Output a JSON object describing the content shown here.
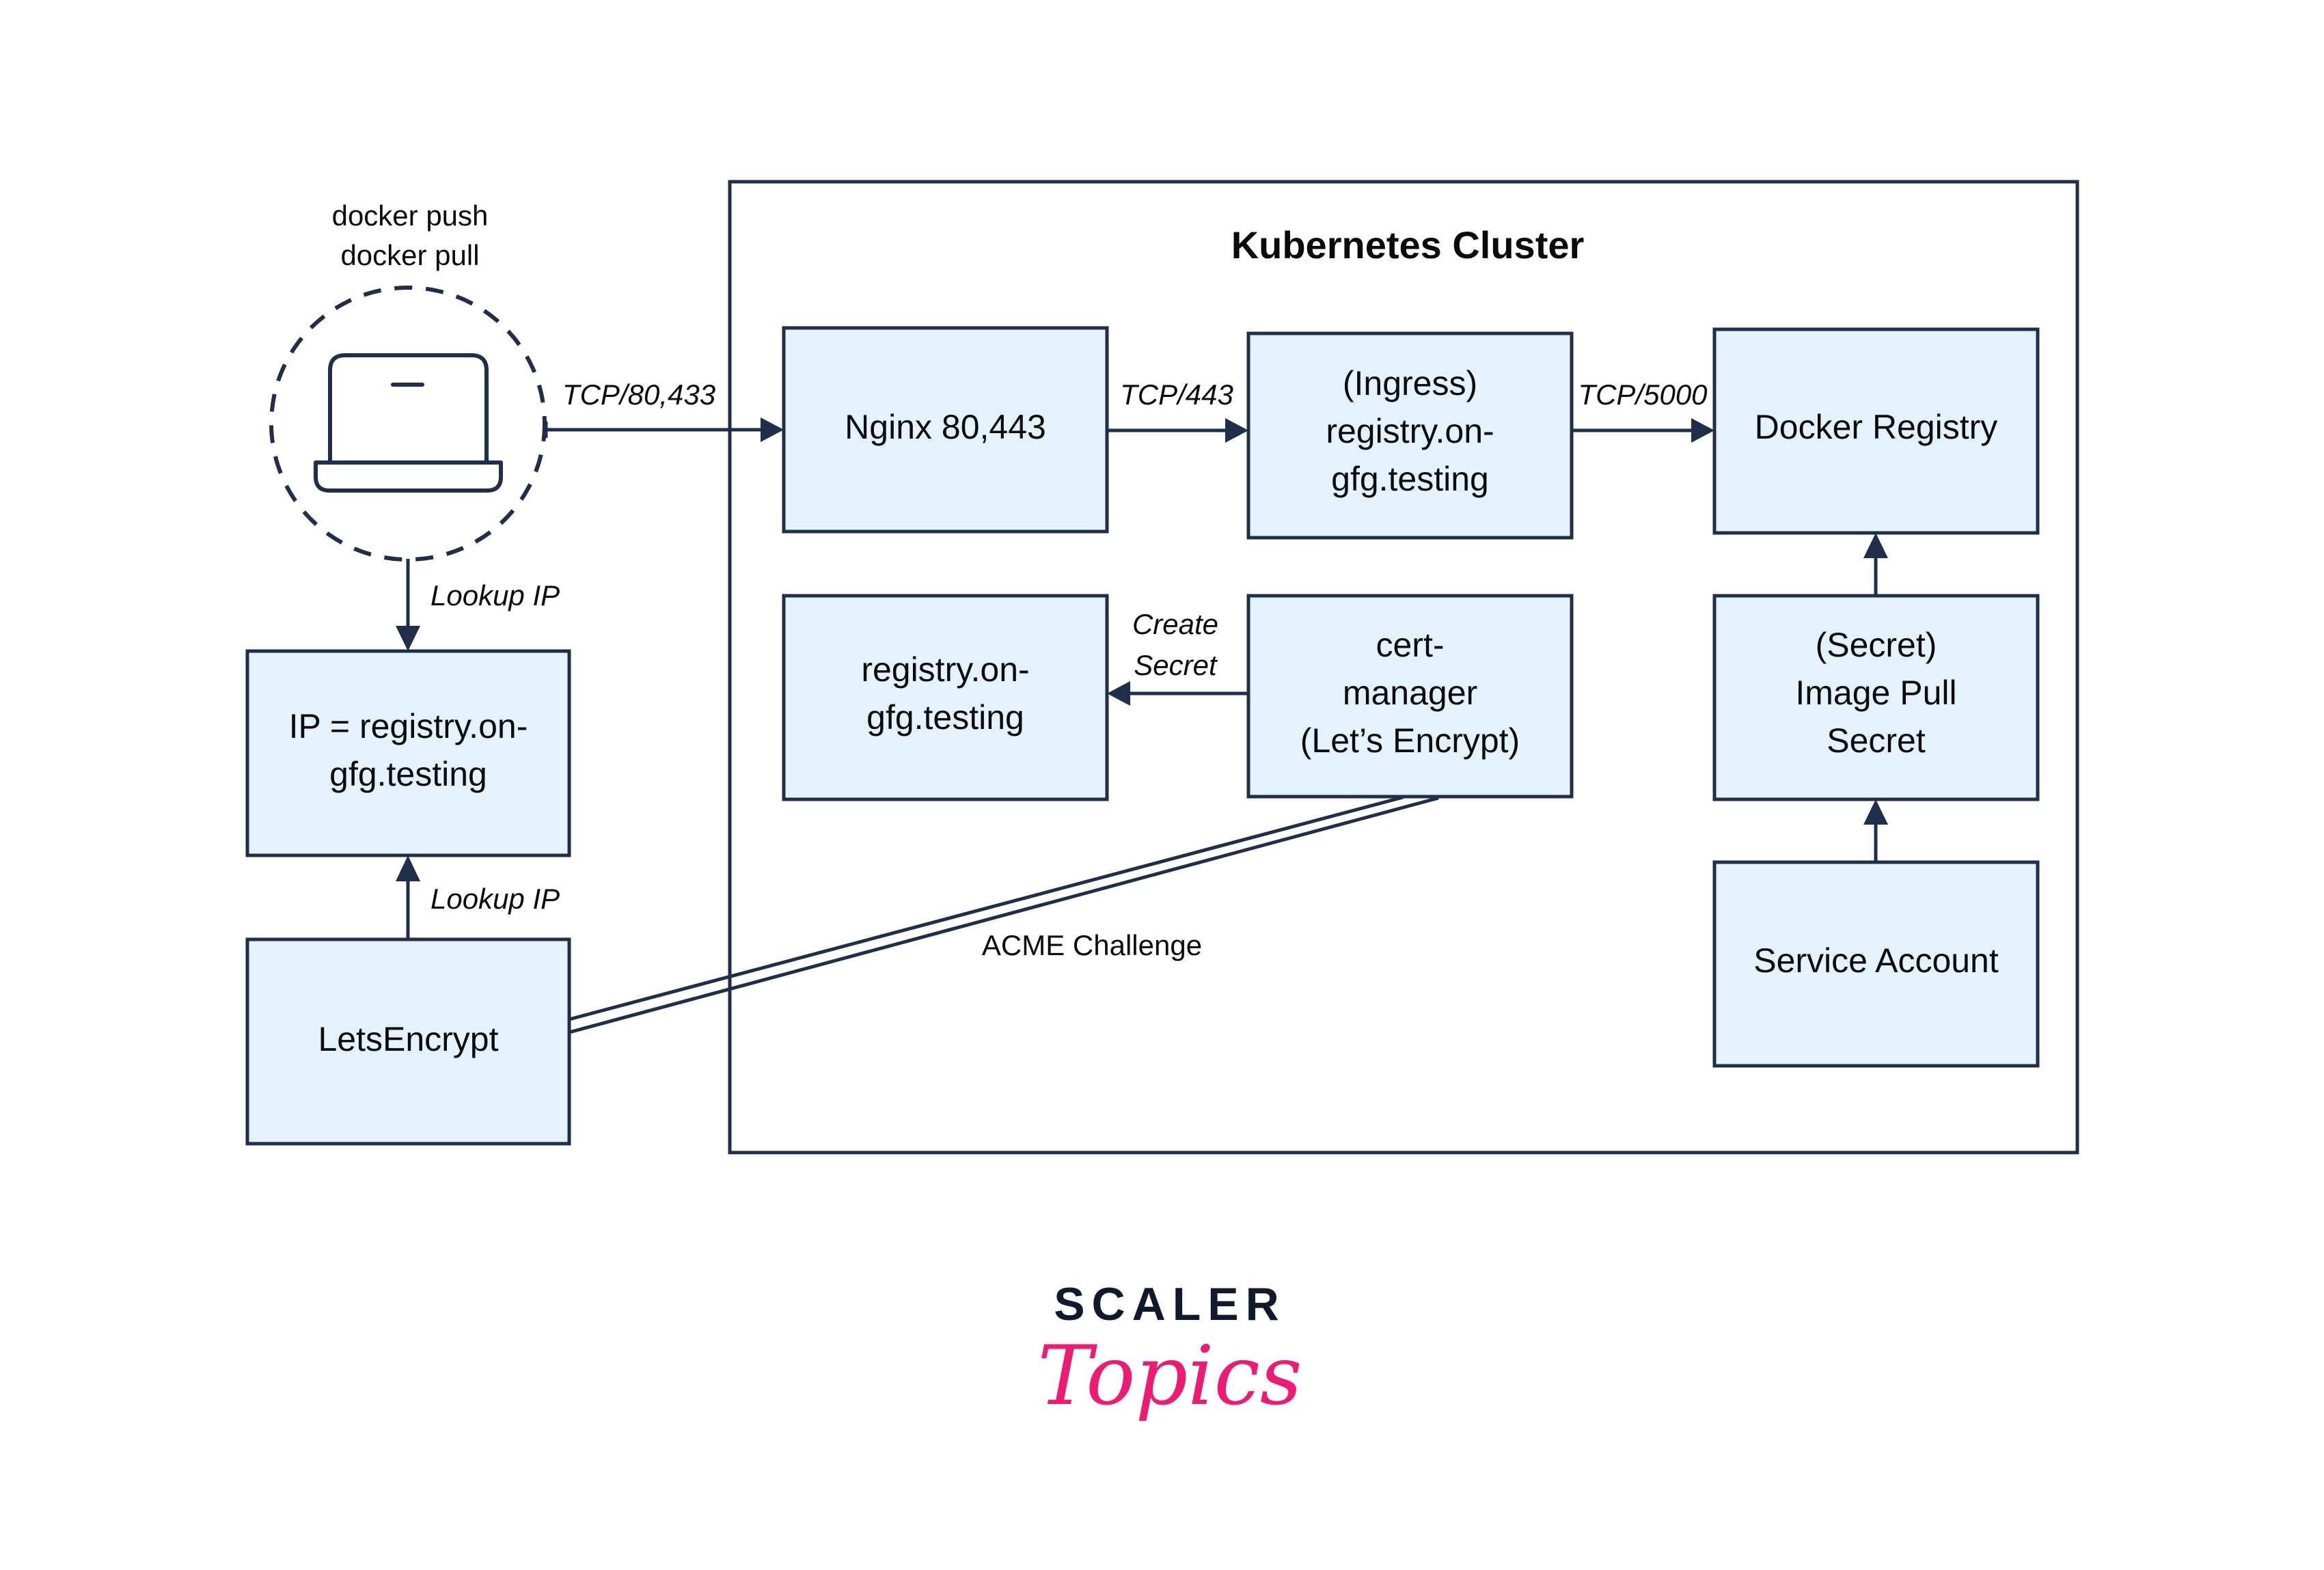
{
  "diagram": {
    "colors": {
      "box_fill": "#E3F2FD",
      "stroke": "#1F2E4A",
      "text": "#0b0b0b",
      "logo_dark": "#0F1A2C",
      "logo_accent": "#EC1C74"
    },
    "client": {
      "icon": "laptop-icon",
      "caption_lines": [
        "docker push",
        "docker pull"
      ]
    },
    "cluster": {
      "title": "Kubernetes Cluster"
    },
    "nodes": {
      "nginx": {
        "lines": [
          "Nginx 80,443"
        ]
      },
      "ingress": {
        "lines": [
          "(Ingress)",
          "registry.on-",
          "gfg.testing"
        ]
      },
      "docker_registry": {
        "lines": [
          "Docker Registry"
        ]
      },
      "tls_secret": {
        "lines": [
          "registry.on-",
          "gfg.testing"
        ]
      },
      "cert_manager": {
        "lines": [
          "cert-",
          "manager",
          "(Let’s Encrypt)"
        ]
      },
      "image_pull_secret": {
        "lines": [
          "(Secret)",
          "Image Pull",
          "Secret"
        ]
      },
      "service_account": {
        "lines": [
          "Service Account"
        ]
      },
      "dns_ip": {
        "lines": [
          "IP = registry.on-",
          "gfg.testing"
        ]
      },
      "letsencrypt": {
        "lines": [
          "LetsEncrypt"
        ]
      }
    },
    "edges": {
      "client_to_nginx": {
        "label": "TCP/80,433"
      },
      "nginx_to_ingress": {
        "label": "TCP/443"
      },
      "ingress_to_registry": {
        "label": "TCP/5000"
      },
      "cert_to_secret": {
        "label_lines": [
          "Create",
          "Secret"
        ]
      },
      "client_to_dns": {
        "label": "Lookup IP"
      },
      "letsencrypt_to_dns": {
        "label": "Lookup IP"
      },
      "acme": {
        "label": "ACME Challenge"
      },
      "pullsecret_to_registry": {
        "label": ""
      },
      "serviceaccount_to_pullsecret": {
        "label": ""
      }
    }
  },
  "branding": {
    "scaler": "SCALER",
    "topics": "Topics"
  }
}
